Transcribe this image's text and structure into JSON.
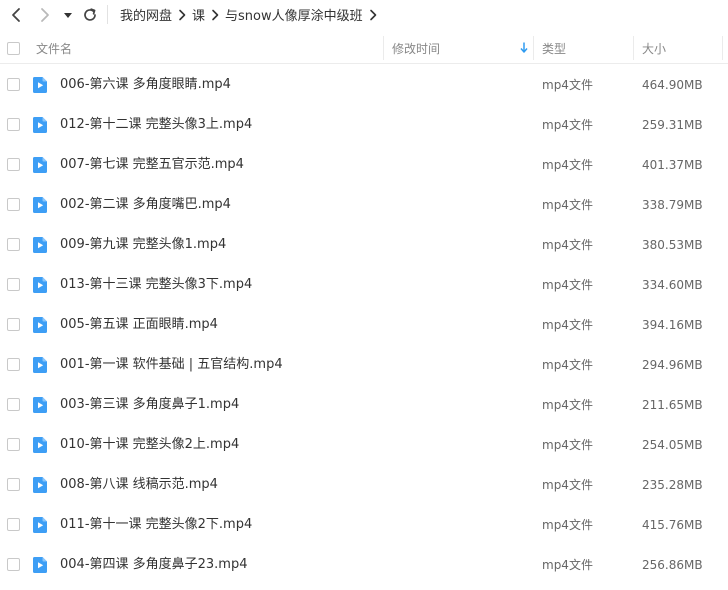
{
  "toolbar": {
    "back": "back-icon",
    "forward": "forward-icon",
    "history": "caret-down-icon",
    "refresh": "refresh-icon"
  },
  "breadcrumb": [
    "我的网盘",
    "课",
    "与snow人像厚涂中级班"
  ],
  "columns": {
    "name": "文件名",
    "modified": "修改时间",
    "type": "类型",
    "size": "大小"
  },
  "sort": {
    "column": "modified",
    "direction": "desc"
  },
  "colors": {
    "accent": "#2f9bf0",
    "file_icon": "#3d9ef5",
    "text": "#333333",
    "muted": "#666666"
  },
  "files": [
    {
      "name": "006-第六课 多角度眼睛.mp4",
      "type": "mp4文件",
      "size": "464.90MB"
    },
    {
      "name": "012-第十二课 完整头像3上.mp4",
      "type": "mp4文件",
      "size": "259.31MB"
    },
    {
      "name": "007-第七课 完整五官示范.mp4",
      "type": "mp4文件",
      "size": "401.37MB"
    },
    {
      "name": "002-第二课 多角度嘴巴.mp4",
      "type": "mp4文件",
      "size": "338.79MB"
    },
    {
      "name": "009-第九课 完整头像1.mp4",
      "type": "mp4文件",
      "size": "380.53MB"
    },
    {
      "name": "013-第十三课 完整头像3下.mp4",
      "type": "mp4文件",
      "size": "334.60MB"
    },
    {
      "name": "005-第五课 正面眼睛.mp4",
      "type": "mp4文件",
      "size": "394.16MB"
    },
    {
      "name": "001-第一课 软件基础 | 五官结构.mp4",
      "type": "mp4文件",
      "size": "294.96MB"
    },
    {
      "name": "003-第三课 多角度鼻子1.mp4",
      "type": "mp4文件",
      "size": "211.65MB"
    },
    {
      "name": "010-第十课 完整头像2上.mp4",
      "type": "mp4文件",
      "size": "254.05MB"
    },
    {
      "name": "008-第八课 线稿示范.mp4",
      "type": "mp4文件",
      "size": "235.28MB"
    },
    {
      "name": "011-第十一课 完整头像2下.mp4",
      "type": "mp4文件",
      "size": "415.76MB"
    },
    {
      "name": "004-第四课 多角度鼻子23.mp4",
      "type": "mp4文件",
      "size": "256.86MB"
    }
  ]
}
